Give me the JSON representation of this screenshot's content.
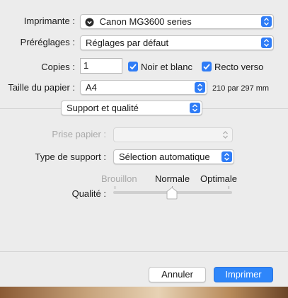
{
  "printer": {
    "label": "Imprimante :",
    "value": "Canon MG3600 series",
    "icon": "printer-status-icon"
  },
  "presets": {
    "label": "Préréglages :",
    "value": "Réglages par défaut"
  },
  "copies": {
    "label": "Copies :",
    "value": "1"
  },
  "black_white": {
    "label": "Noir et blanc",
    "checked": true
  },
  "two_sided": {
    "label": "Recto verso",
    "checked": true
  },
  "paper_size": {
    "label": "Taille du papier :",
    "value": "A4",
    "dimensions": "210 par 297 mm"
  },
  "section": {
    "value": "Support et qualité"
  },
  "paper_feed": {
    "label": "Prise papier :",
    "value": "",
    "disabled": true
  },
  "media_type": {
    "label": "Type de support :",
    "value": "Sélection automatique"
  },
  "quality": {
    "label": "Qualité :",
    "levels": [
      "Brouillon",
      "Normale",
      "Optimale"
    ],
    "selected": "Normale",
    "position": 0.5
  },
  "buttons": {
    "cancel": "Annuler",
    "print": "Imprimer"
  },
  "colors": {
    "accent": "#2f7cf6",
    "default_button": "#2e86fa"
  }
}
